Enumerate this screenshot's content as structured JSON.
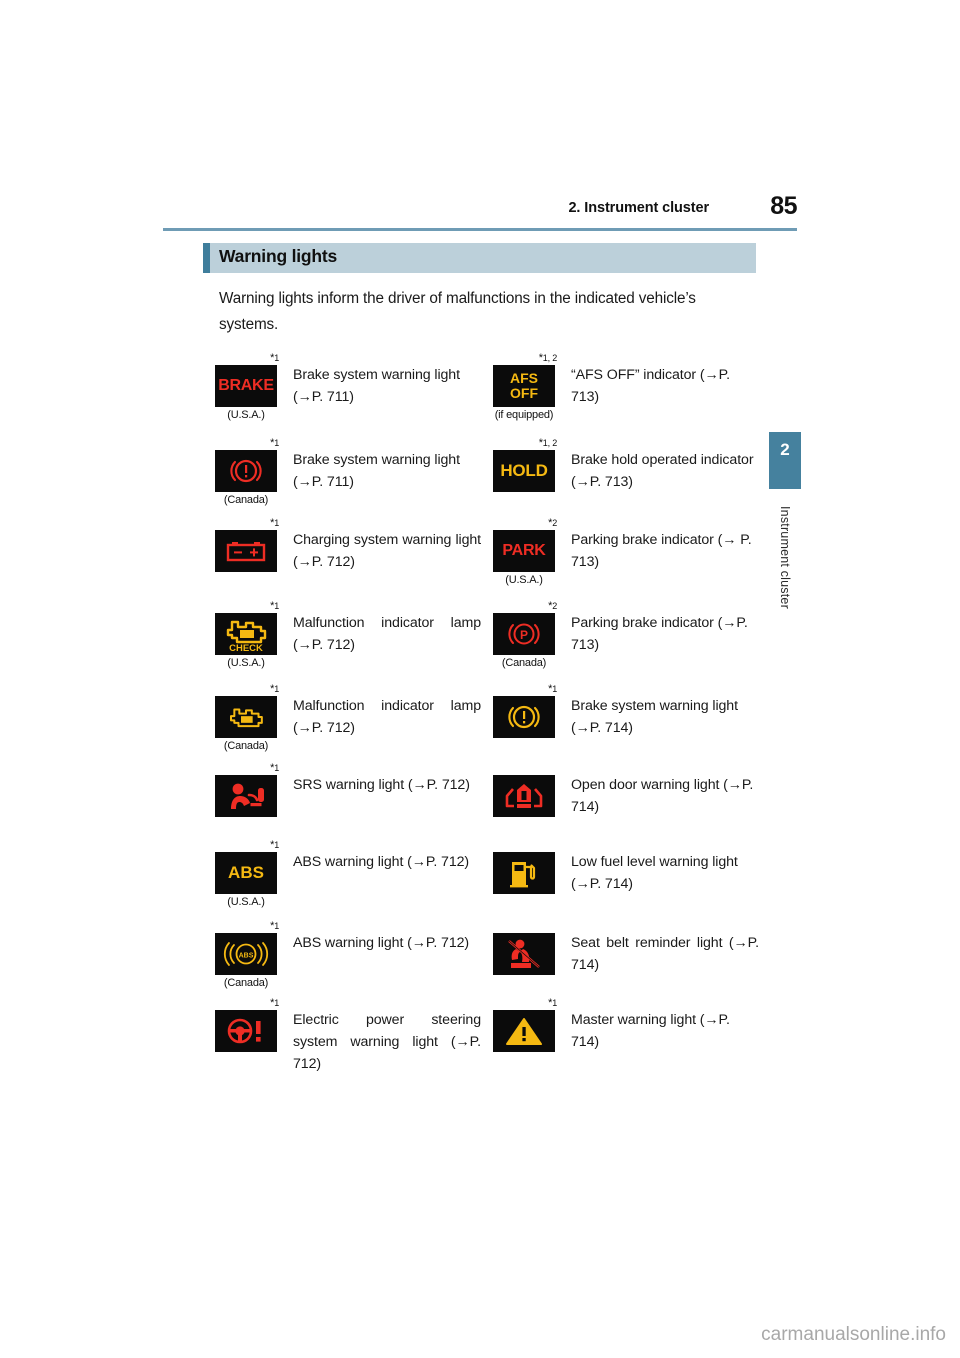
{
  "header": {
    "chapter_title": "2. Instrument cluster",
    "page_number": "85"
  },
  "section": {
    "title": "Warning lights"
  },
  "intro": {
    "text": "Warning lights inform the driver of malfunctions in the indicated vehicle’s systems."
  },
  "chapter_tab": {
    "number": "2",
    "label": "Instrument cluster"
  },
  "watermark": {
    "text": "carmanualsonline.info"
  },
  "table": {
    "rows": [
      {
        "left": {
          "footnote": "*1",
          "icon": "brake-text-warning-icon",
          "icon_text": "BRAKE",
          "icon_note": "(U.S.A.)",
          "description": "Brake system warning light (→P. 711)"
        },
        "right": {
          "footnote": "*1, 2",
          "icon": "afs-off-indicator-icon",
          "icon_text": "AFS OFF",
          "icon_note": "(if equipped)",
          "description": "“AFS OFF” indicator (→P. 713)"
        }
      },
      {
        "left": {
          "footnote": "*1",
          "icon": "brake-circle-exclamation-red-icon",
          "icon_text": "",
          "icon_note": "(Canada)",
          "description": "Brake system warning light (→P. 711)"
        },
        "right": {
          "footnote": "*1, 2",
          "icon": "hold-indicator-icon",
          "icon_text": "HOLD",
          "icon_note": "",
          "description": "Brake hold operated indicator (→P. 713)"
        }
      },
      {
        "left": {
          "footnote": "*1",
          "icon": "battery-charging-icon",
          "icon_text": "",
          "icon_note": "",
          "description": "Charging system warning light (→P. 712)"
        },
        "right": {
          "footnote": "*2",
          "icon": "park-text-indicator-icon",
          "icon_text": "PARK",
          "icon_note": "(U.S.A.)",
          "description": "Parking brake indicator (→ P. 713)"
        }
      },
      {
        "left": {
          "footnote": "*1",
          "icon": "check-engine-check-icon",
          "icon_text": "CHECK",
          "icon_note": "(U.S.A.)",
          "description": "Malfunction indicator lamp (→P. 712)"
        },
        "right": {
          "footnote": "*2",
          "icon": "parking-brake-p-circle-icon",
          "icon_text": "",
          "icon_note": "(Canada)",
          "description": "Parking brake indicator (→P. 713)"
        }
      },
      {
        "left": {
          "footnote": "*1",
          "icon": "check-engine-icon",
          "icon_text": "",
          "icon_note": "(Canada)",
          "description": "Malfunction indicator lamp (→P. 712)"
        },
        "right": {
          "footnote": "*1",
          "icon": "brake-circle-exclamation-amber-icon",
          "icon_text": "",
          "icon_note": "",
          "description": "Brake system warning light (→P. 714)"
        }
      },
      {
        "left": {
          "footnote": "*1",
          "icon": "srs-airbag-icon",
          "icon_text": "",
          "icon_note": "",
          "description": "SRS warning light (→P. 712)"
        },
        "right": {
          "footnote": "",
          "icon": "open-door-icon",
          "icon_text": "",
          "icon_note": "",
          "description": "Open door warning light (→P. 714)"
        }
      },
      {
        "left": {
          "footnote": "*1",
          "icon": "abs-text-icon",
          "icon_text": "ABS",
          "icon_note": "(U.S.A.)",
          "description": "ABS warning light (→P. 712)"
        },
        "right": {
          "footnote": "",
          "icon": "fuel-pump-icon",
          "icon_text": "",
          "icon_note": "",
          "description": "Low fuel level warning light (→P. 714)"
        }
      },
      {
        "left": {
          "footnote": "*1",
          "icon": "abs-circle-icon",
          "icon_text": "ABS",
          "icon_note": "(Canada)",
          "description": "ABS warning light (→P. 712)"
        },
        "right": {
          "footnote": "",
          "icon": "seat-belt-reminder-icon",
          "icon_text": "",
          "icon_note": "",
          "description": "Seat belt reminder light (→P. 714)"
        }
      },
      {
        "left": {
          "footnote": "*1",
          "icon": "electric-power-steering-icon",
          "icon_text": "",
          "icon_note": "",
          "description": "Electric power steering system warning light (→P. 712)"
        },
        "right": {
          "footnote": "*1",
          "icon": "master-warning-triangle-icon",
          "icon_text": "",
          "icon_note": "",
          "description": "Master warning light (→P. 714)"
        }
      }
    ]
  },
  "colors": {
    "accent_band": "#bcd0da",
    "accent_tab": "#3f7e9c",
    "rule": "#6f9cb5",
    "icon_red": "#ee2d24",
    "icon_amber": "#f5b912",
    "icon_bg": "#0b0b0b"
  }
}
